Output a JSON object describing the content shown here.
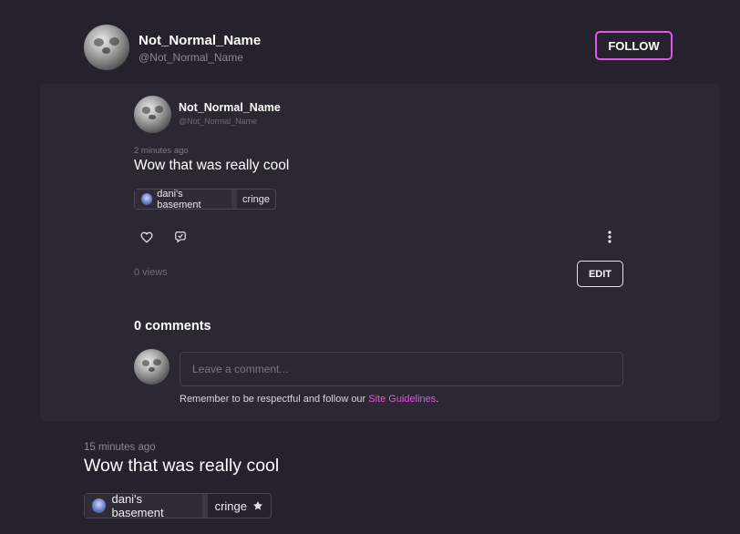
{
  "author": {
    "display_name": "Not_Normal_Name",
    "handle": "@Not_Normal_Name",
    "follow_label": "FOLLOW"
  },
  "embedded_post": {
    "author_name": "Not_Normal_Name",
    "author_handle": "@Not_Normal_Name",
    "timestamp": "2 minutes ago",
    "text": "Wow that was really cool",
    "community": "dani's basement",
    "tag": "cringe",
    "views": "0 views",
    "edit_label": "EDIT",
    "actions": {
      "like_icon": "heart-icon",
      "reblog_icon": "reblog-icon",
      "menu_icon": "more-vertical-icon"
    }
  },
  "comments": {
    "title": "0 comments",
    "placeholder": "Leave a comment...",
    "notice_prefix": "Remember to be respectful and follow our ",
    "guidelines_link": "Site Guidelines",
    "notice_suffix": "."
  },
  "main_post": {
    "timestamp": "15 minutes ago",
    "text": "Wow that was really cool",
    "community": "dani's basement",
    "tag": "cringe",
    "star_icon": "star-icon"
  },
  "colors": {
    "background": "#25212d",
    "panel": "#2c2833",
    "accent": "#e255e8"
  }
}
